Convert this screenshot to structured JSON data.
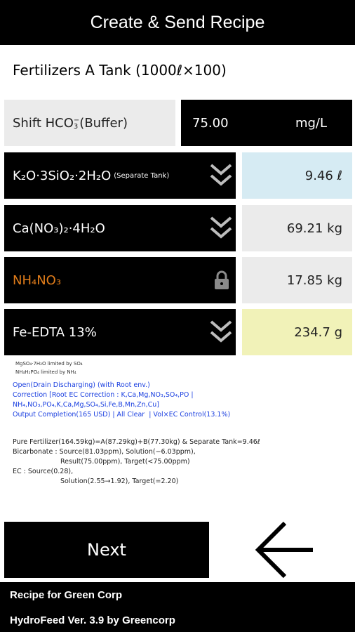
{
  "header": {
    "title": "Create & Send Recipe"
  },
  "tank_title": "Fertilizers A Tank (1000ℓ×100)",
  "shift": {
    "label_prefix": "Shift HCO",
    "label_sub": "3",
    "label_sup": "−",
    "label_suffix": " (Buffer)",
    "value": "75.00",
    "unit": "mg/L"
  },
  "rows": [
    {
      "label": "K₂O·3SiO₂·2H₂O",
      "label_note": "(Separate Tank)",
      "value": "9.46 ℓ",
      "value_bg": "#d6ebf3",
      "icon": "chevron-double-down-icon"
    },
    {
      "label": "Ca(NO₃)₂·4H₂O",
      "label_note": "",
      "value": "69.21 kg",
      "value_bg": "#ebebeb",
      "icon": "chevron-double-down-icon"
    },
    {
      "label": "NH₄NO₃",
      "label_note": "",
      "value": "17.85 kg",
      "value_bg": "#ebebeb",
      "label_color": "#e07c1a",
      "icon": "lock-icon"
    },
    {
      "label": "Fe-EDTA 13%",
      "label_note": "",
      "value": "234.7 g",
      "value_bg": "#f1f2b8",
      "icon": "chevron-double-down-icon"
    }
  ],
  "notes": {
    "small_1": "MgSO₄·7H₂O limited by SO₄",
    "small_2": "NH₄H₂PO₄ limited by NH₄",
    "blue_1": "Open(Drain Discharging) (with Root env.)",
    "blue_2": "Correction [Root EC Correction : K,Ca,Mg,NO₃,SO₄,PO |",
    "blue_3": "NH₄,NO₃,PO₄,K,Ca,Mg,SO₄,Si,Fe,B,Mn,Zn,Cu]",
    "blue_4": "Output Completion(165 USD) | All Clear  | Vol×EC Control(13.1%)",
    "black_1": "Pure Fertilizer(164.59kg)=A(87.29kg)+B(77.30kg) & Separate Tank=9.46ℓ",
    "black_2": "Bicarbonate : Source(81.03ppm), Solution(−6.03ppm),",
    "black_3": "Result(75.00ppm), Target(<75.00ppm)",
    "black_4": "EC : Source(0.28),",
    "black_5": "Solution(2.55→1.92), Target(=2.20)"
  },
  "next_label": "Next",
  "footer": {
    "line1": "Recipe for Green Corp",
    "line2": "HydroFeed Ver. 3.9 by Greencorp"
  }
}
